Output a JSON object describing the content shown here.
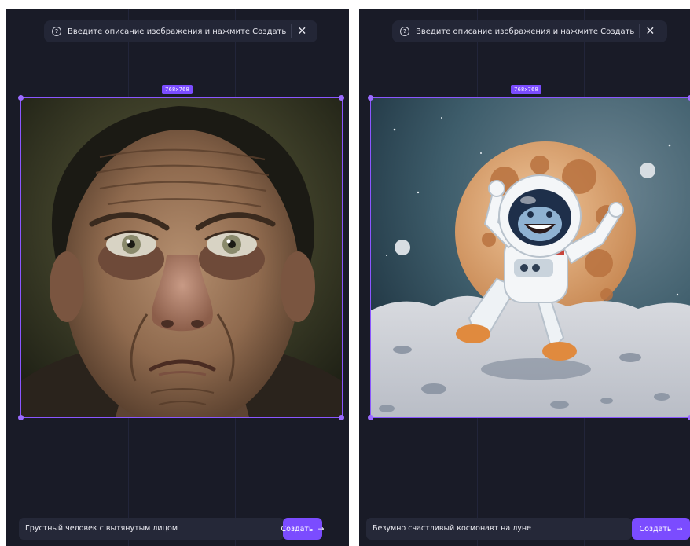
{
  "panels": [
    {
      "hint": {
        "text": "Введите описание изображения и нажмите Создать",
        "icon": "question-circle-icon",
        "close_icon": "close-icon",
        "close_glyph": "✕"
      },
      "size_label": "768x768",
      "image": "portrait of a sad man with a long face",
      "prompt": "Грустный человек с вытянутым лицом",
      "create_button": "Создать",
      "arrow": "→"
    },
    {
      "hint": {
        "text": "Введите описание изображения и нажмите Создать",
        "icon": "question-circle-icon",
        "close_icon": "close-icon",
        "close_glyph": "✕"
      },
      "size_label": "768x768",
      "image": "cartoon astronaut dancing on the moon",
      "prompt": "Безумно счастливый космонавт на луне",
      "create_button": "Создать",
      "arrow": "→"
    }
  ],
  "colors": {
    "background": "#191b27",
    "accent": "#7b4cff",
    "field": "#252838"
  }
}
